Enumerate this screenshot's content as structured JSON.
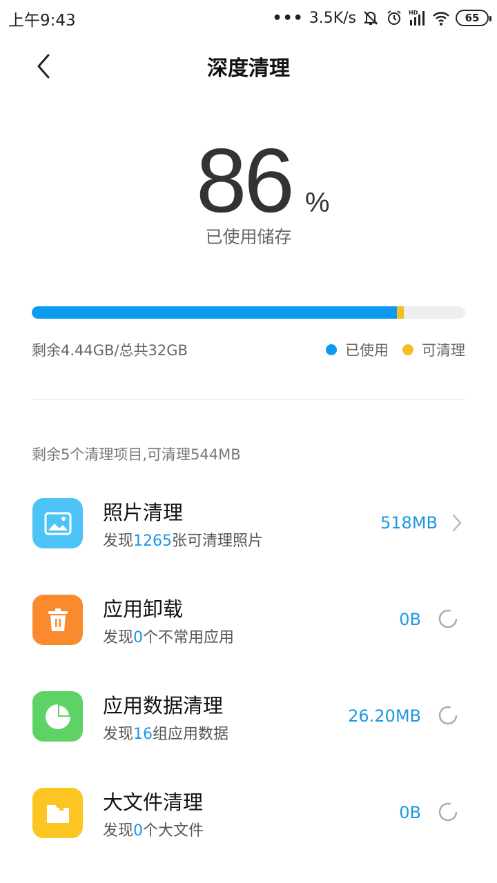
{
  "status_bar": {
    "time": "上午9:43",
    "dots": "•••",
    "speed": "3.5K/s",
    "battery": "65",
    "icons": [
      "mute-bell-icon",
      "alarm-icon",
      "hd-signal-icon",
      "wifi-icon",
      "battery-icon"
    ]
  },
  "header": {
    "title": "深度清理",
    "back_icon": "chevron-left-icon"
  },
  "usage": {
    "number": "86",
    "percent_sign": "%",
    "label": "已使用储存",
    "used_fraction": 0.842,
    "cleanable_fraction": 0.017
  },
  "storage": {
    "text": "剩余4.44GB/总共32GB",
    "legend_used": "已使用",
    "legend_cleanable": "可清理"
  },
  "colors": {
    "used": "#0e9af0",
    "cleanable": "#f5bf22",
    "accent": "#1a97e6"
  },
  "summary": "剩余5个清理项目,可清理544MB",
  "items": [
    {
      "title": "照片清理",
      "desc_prefix": "发现",
      "desc_num": "1265",
      "desc_suffix": "张可清理照片",
      "size": "518MB",
      "icon": "photo-icon",
      "icon_color": "#4ec3f7",
      "action": "chevron-right-icon"
    },
    {
      "title": "应用卸载",
      "desc_prefix": "发现",
      "desc_num": "0",
      "desc_suffix": "个不常用应用",
      "size": "0B",
      "icon": "trash-icon",
      "icon_color": "#f98a2e",
      "action": "loading-spinner-icon"
    },
    {
      "title": "应用数据清理",
      "desc_prefix": "发现",
      "desc_num": "16",
      "desc_suffix": "组应用数据",
      "size": "26.20MB",
      "icon": "pie-chart-icon",
      "icon_color": "#5fd266",
      "action": "loading-spinner-icon"
    },
    {
      "title": "大文件清理",
      "desc_prefix": "发现",
      "desc_num": "0",
      "desc_suffix": "个大文件",
      "size": "0B",
      "icon": "folder-icon",
      "icon_color": "#fcc521",
      "action": "loading-spinner-icon"
    }
  ]
}
